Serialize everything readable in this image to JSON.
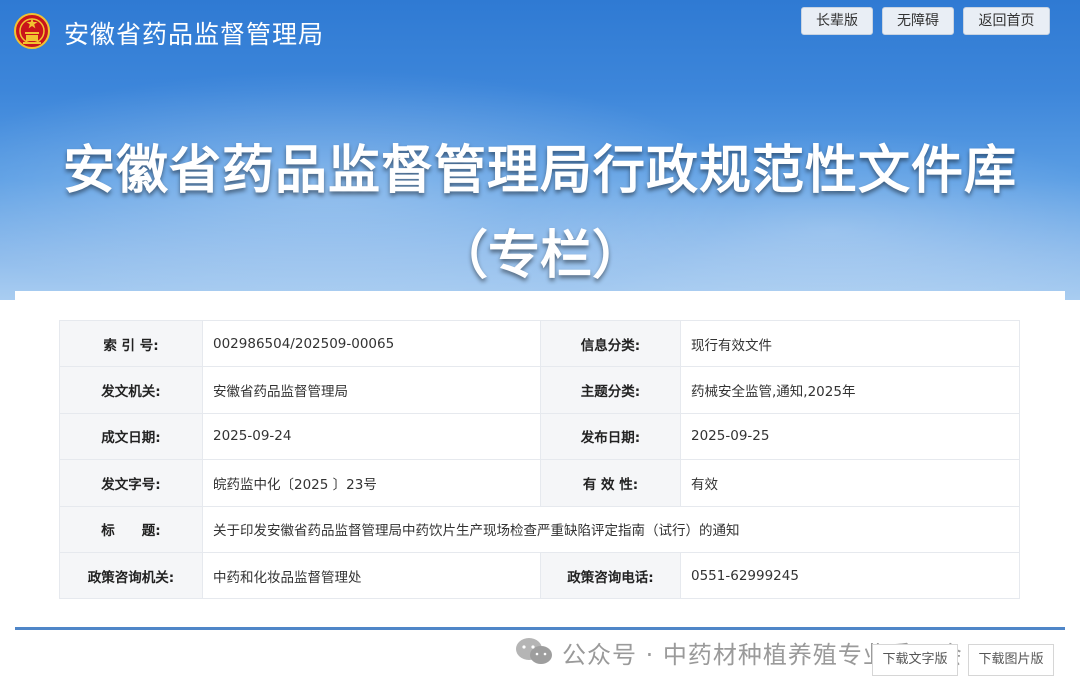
{
  "header": {
    "site_name": "安徽省药品监督管理局",
    "buttons": [
      "长辈版",
      "无障碍",
      "返回首页"
    ]
  },
  "banner": {
    "title": "安徽省药品监督管理局行政规范性文件库",
    "subtitle": "（专栏）"
  },
  "info_table": {
    "rows": [
      {
        "label1": "索 引 号:",
        "value1": "002986504/202509-00065",
        "label2": "信息分类:",
        "value2": "现行有效文件"
      },
      {
        "label1": "发文机关:",
        "value1": "安徽省药品监督管理局",
        "label2": "主题分类:",
        "value2": "药械安全监管,通知,2025年"
      },
      {
        "label1": "成文日期:",
        "value1": "2025-09-24",
        "label2": "发布日期:",
        "value2": "2025-09-25"
      },
      {
        "label1": "发文字号:",
        "value1": "皖药监中化〔2025 〕23号",
        "label2": "有 效 性:",
        "value2": "有效"
      },
      {
        "label1": "标　　题:",
        "value1": "关于印发安徽省药品监督管理局中药饮片生产现场检查严重缺陷评定指南（试行）的通知"
      },
      {
        "label1": "政策咨询机关:",
        "value1": "中药和化妆品监督管理处",
        "label2": "政策咨询电话:",
        "value2": "0551-62999245"
      }
    ]
  },
  "watermark": {
    "text": "公众号 · 中药材种植养殖专业委员会"
  },
  "downloads": {
    "text_version": "下载文字版",
    "image_version": "下载图片版"
  },
  "colors": {
    "banner_top": "#2f7ad3",
    "banner_bottom": "#a9cdf1",
    "divider": "#4f86c8",
    "label_bg": "#f5f6f8"
  }
}
